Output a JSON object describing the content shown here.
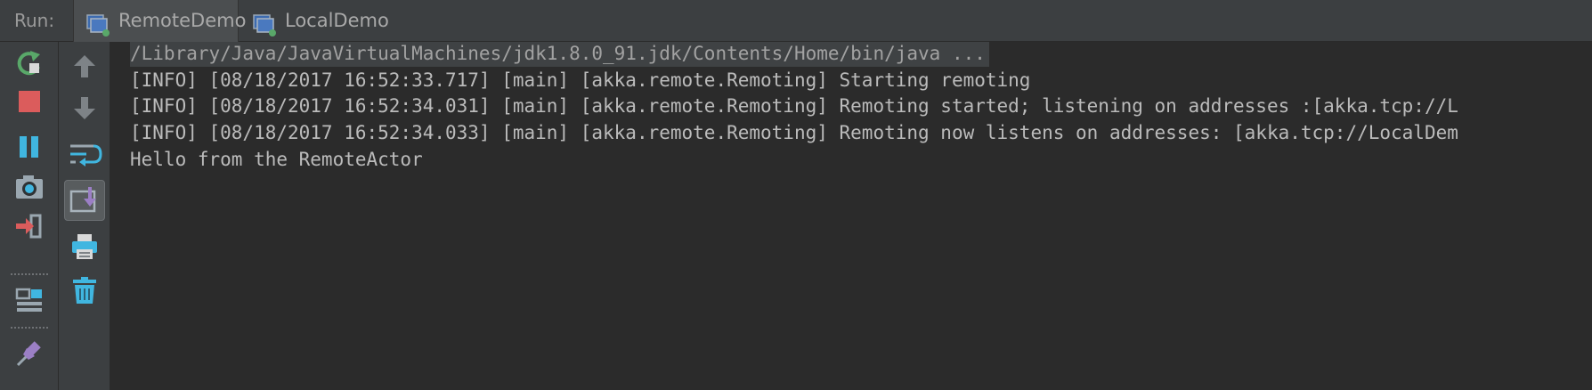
{
  "run_panel": {
    "label": "Run:",
    "tabs": [
      {
        "label": "RemoteDemo",
        "icon": "run-config-icon"
      },
      {
        "label": "LocalDemo",
        "icon": "run-config-icon"
      }
    ]
  },
  "toolbar": {
    "primary": [
      "rerun-icon",
      "stop-icon",
      "pause-icon",
      "camera-icon",
      "exit-icon",
      "layout-icon",
      "pin-icon"
    ],
    "secondary": [
      "arrow-up-icon",
      "arrow-down-icon",
      "soft-wrap-icon",
      "scroll-to-end-icon",
      "print-icon",
      "trash-icon"
    ]
  },
  "console": {
    "lines": [
      "/Library/Java/JavaVirtualMachines/jdk1.8.0_91.jdk/Contents/Home/bin/java ...",
      "[INFO] [08/18/2017 16:52:33.717] [main] [akka.remote.Remoting] Starting remoting",
      "[INFO] [08/18/2017 16:52:34.031] [main] [akka.remote.Remoting] Remoting started; listening on addresses :[akka.tcp://L",
      "[INFO] [08/18/2017 16:52:34.033] [main] [akka.remote.Remoting] Remoting now listens on addresses: [akka.tcp://LocalDem",
      "Hello from the RemoteActor"
    ]
  },
  "colors": {
    "background": "#2b2b2b",
    "panel": "#3c3f41",
    "text": "#bbbbbb",
    "green": "#59a869",
    "red": "#db5c5c",
    "blue": "#40b6e0"
  }
}
